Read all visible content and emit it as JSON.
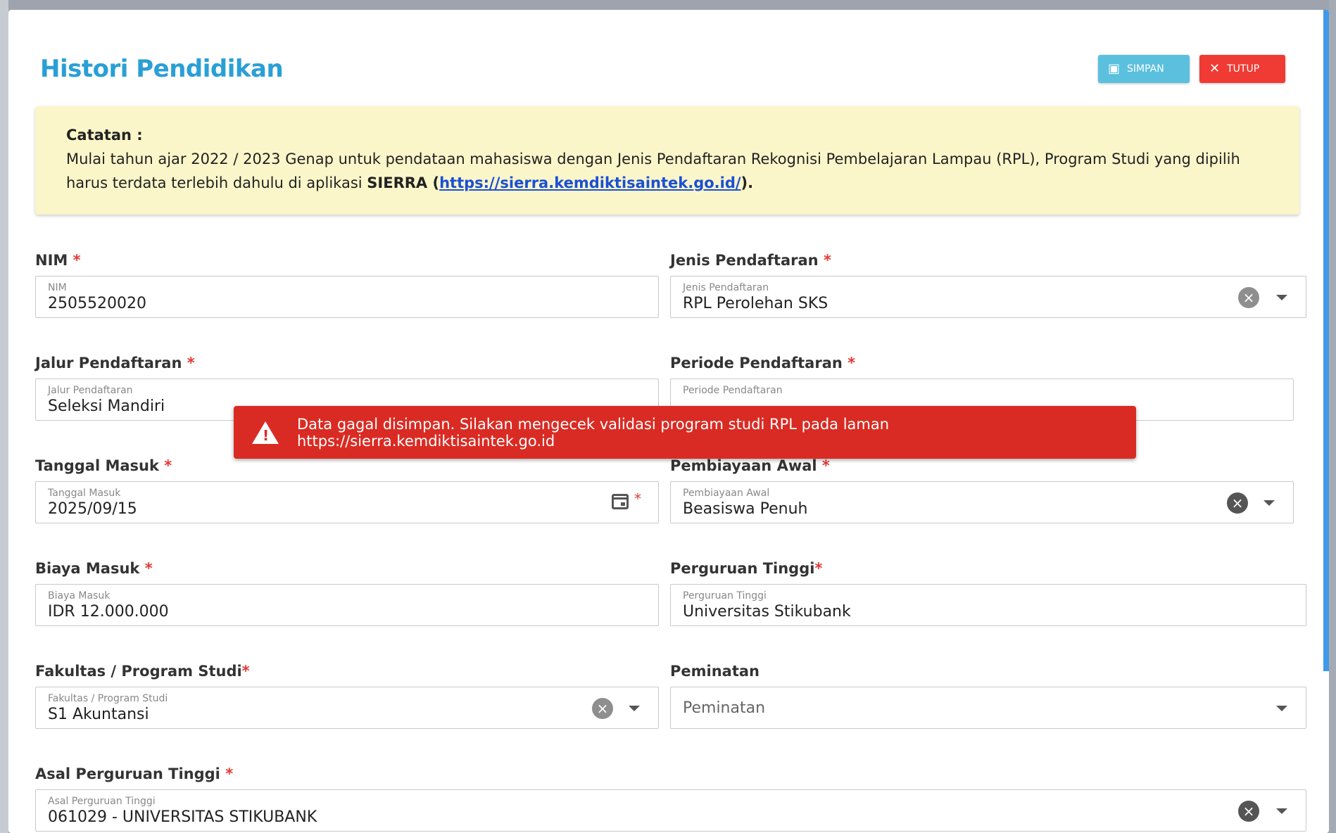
{
  "dialog": {
    "title": "Histori Pendidikan",
    "save_label": "SIMPAN",
    "close_label": "TUTUP"
  },
  "note": {
    "title": "Catatan :",
    "text_before": "Mulai tahun ajar 2022 / 2023 Genap untuk pendataan mahasiswa dengan Jenis Pendaftaran Rekognisi Pembelajaran Lampau (RPL), Program Studi yang dipilih harus terdata terlebih dahulu di aplikasi ",
    "app_name": "SIERRA",
    "link_open": " (",
    "link": "https://sierra.kemdiktisaintek.go.id/",
    "link_close": ")."
  },
  "fields": {
    "nim": {
      "label": "NIM",
      "small": "NIM",
      "value": "2505520020"
    },
    "jenis": {
      "label": "Jenis Pendaftaran",
      "small": "Jenis Pendaftaran",
      "value": "RPL Perolehan SKS"
    },
    "jalur": {
      "label": "Jalur Pendaftaran",
      "small": "Jalur Pendaftaran",
      "value": "Seleksi Mandiri"
    },
    "periode": {
      "label": "Periode Pendaftaran",
      "small": "Periode Pendaftaran",
      "value": ""
    },
    "tanggal": {
      "label": "Tanggal Masuk",
      "small": "Tanggal Masuk",
      "value": "2025/09/15"
    },
    "pembiayaan": {
      "label": "Pembiayaan Awal",
      "small": "Pembiayaan Awal",
      "value": "Beasiswa Penuh"
    },
    "biaya": {
      "label": "Biaya Masuk",
      "small": "Biaya Masuk",
      "value": "IDR 12.000.000"
    },
    "pt": {
      "label": "Perguruan Tinggi",
      "small": "Perguruan Tinggi",
      "value": "Universitas Stikubank"
    },
    "prodi": {
      "label": "Fakultas / Program Studi",
      "small": "Fakultas / Program Studi",
      "value": "S1 Akuntansi"
    },
    "peminatan": {
      "label": "Peminatan",
      "placeholder": "Peminatan"
    },
    "asal": {
      "label": "Asal Perguruan Tinggi",
      "small": "Asal Perguruan Tinggi",
      "value": "061029 - UNIVERSITAS STIKUBANK"
    }
  },
  "required_mark": "*",
  "toast": {
    "message": "Data gagal disimpan. Silakan mengecek validasi program studi RPL pada laman https://sierra.kemdiktisaintek.go.id"
  },
  "colors": {
    "title": "#2a9fd6",
    "save_button": "#5bc0de",
    "close_button": "#ef3b34",
    "note_bg": "#fbf6c9",
    "toast_bg": "#d92b23",
    "required": "#e53935"
  }
}
